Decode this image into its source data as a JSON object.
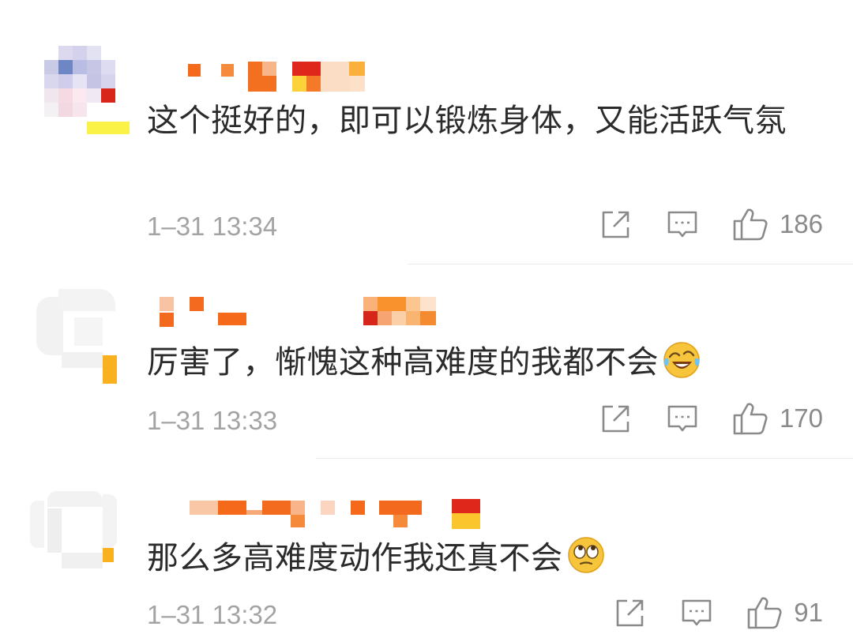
{
  "comments": [
    {
      "text": "这个挺好的，即可以锻炼身体，又能活跃气氛",
      "emoji": "",
      "time": "1–31 13:34",
      "likes": "186",
      "icons": [
        "share-icon",
        "comment-icon",
        "like-icon"
      ]
    },
    {
      "text": "厉害了，惭愧这种高难度的我都不会",
      "emoji": "laugh-cry-emoji",
      "time": "1–31 13:33",
      "likes": "170",
      "icons": [
        "share-icon",
        "comment-icon",
        "like-icon"
      ]
    },
    {
      "text": "那么多高难度动作我还真不会",
      "emoji": "rolling-eyes-emoji",
      "time": "1–31 13:32",
      "likes": "91",
      "icons": [
        "share-icon",
        "comment-icon",
        "like-icon"
      ]
    }
  ],
  "colors": {
    "text": "#2b2b2b",
    "meta": "#a3a3a3",
    "icon": "#8a8a8a",
    "divider": "#e9e9e9",
    "mosaic_orange": "#f26c1b",
    "mosaic_red": "#e0271b",
    "mosaic_yellow": "#f9c02b"
  }
}
